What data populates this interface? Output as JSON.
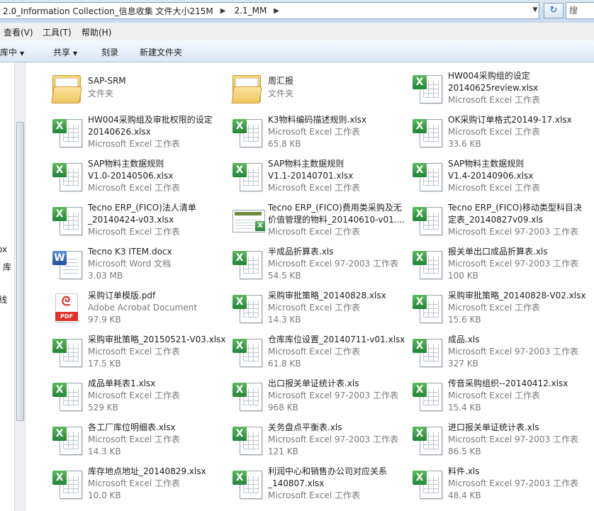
{
  "address": {
    "path": [
      "2.0_Information Collection_信息收集 文件大小215M",
      "2.1_MM"
    ],
    "search_placeholder": "搜"
  },
  "menu": [
    "查看(V)",
    "工具(T)",
    "帮助(H)"
  ],
  "toolbar": {
    "library": "到库中",
    "share": "共享",
    "burn": "刻录",
    "new_folder": "新建文件夹"
  },
  "nav": [
    "ox",
    "库",
    "线"
  ],
  "files": [
    {
      "name": "SAP-SRM",
      "line2": "",
      "type": "文件夹",
      "size": "",
      "icon": "folder"
    },
    {
      "name": "周汇报",
      "line2": "",
      "type": "文件夹",
      "size": "",
      "icon": "folder"
    },
    {
      "name": "HW004采购组的设定",
      "line2": "20140625review.xlsx",
      "type": "Microsoft Excel 工作表",
      "size": "",
      "icon": "excel"
    },
    {
      "name": "HW004采购组及审批权限的设定",
      "line2": "20140626.xlsx",
      "type": "Microsoft Excel 工作表",
      "size": "",
      "icon": "excel"
    },
    {
      "name": "K3物料编码描述规则.xlsx",
      "line2": "",
      "type": "Microsoft Excel 工作表",
      "size": "65.8 KB",
      "icon": "excel"
    },
    {
      "name": "OK采购订单格式20149-17.xlsx",
      "line2": "",
      "type": "Microsoft Excel 工作表",
      "size": "33.6 KB",
      "icon": "excel"
    },
    {
      "name": "SAP物料主数据规则",
      "line2": "V1.0-20140506.xlsx",
      "type": "Microsoft Excel 工作表",
      "size": "",
      "icon": "excel"
    },
    {
      "name": "SAP物料主数据规则",
      "line2": "V1.1-20140701.xlsx",
      "type": "Microsoft Excel 工作表",
      "size": "",
      "icon": "excel"
    },
    {
      "name": "SAP物料主数据规则",
      "line2": "V1.4-20140906.xlsx",
      "type": "Microsoft Excel 工作表",
      "size": "",
      "icon": "excel"
    },
    {
      "name": "Tecno ERP_(FICO)法人清单",
      "line2": "_20140424-v03.xlsx",
      "type": "Microsoft Excel 工作表",
      "size": "",
      "icon": "excel"
    },
    {
      "name": "Tecno ERP_(FICO)费用类采购及无",
      "line2": "价值管理的物料_20140610-v01....",
      "type": "Microsoft Excel 工作表",
      "size": "",
      "icon": "image"
    },
    {
      "name": "Tecno ERP_(FICO)移动类型科目决",
      "line2": "定表_20140827v09.xls",
      "type": "Microsoft Excel 97-2003 工作表",
      "size": "",
      "icon": "excel"
    },
    {
      "name": "Tecno K3 ITEM.docx",
      "line2": "",
      "type": "Microsoft Word 文档",
      "size": "3.03 MB",
      "icon": "word"
    },
    {
      "name": "半成品折算表.xls",
      "line2": "",
      "type": "Microsoft Excel 97-2003 工作表",
      "size": "54.5 KB",
      "icon": "excel"
    },
    {
      "name": "报关单出口成品折算表.xls",
      "line2": "",
      "type": "Microsoft Excel 97-2003 工作表",
      "size": "100 KB",
      "icon": "excel"
    },
    {
      "name": "采购订单模版.pdf",
      "line2": "",
      "type": "Adobe Acrobat Document",
      "size": "97.9 KB",
      "icon": "pdf"
    },
    {
      "name": "采购审批策略_20140828.xlsx",
      "line2": "",
      "type": "Microsoft Excel 工作表",
      "size": "14.3 KB",
      "icon": "excel"
    },
    {
      "name": "采购审批策略_20140828-V02.xlsx",
      "line2": "",
      "type": "Microsoft Excel 工作表",
      "size": "15.6 KB",
      "icon": "excel"
    },
    {
      "name": "采购审批策略_20150521-V03.xlsx",
      "line2": "",
      "type": "Microsoft Excel 工作表",
      "size": "17.5 KB",
      "icon": "excel"
    },
    {
      "name": "仓库库位设置_20140711-v01.xlsx",
      "line2": "",
      "type": "Microsoft Excel 工作表",
      "size": "61.8 KB",
      "icon": "excel"
    },
    {
      "name": "成品.xls",
      "line2": "",
      "type": "Microsoft Excel 97-2003 工作表",
      "size": "327 KB",
      "icon": "excel"
    },
    {
      "name": "成品单耗表1.xlsx",
      "line2": "",
      "type": "Microsoft Excel 工作表",
      "size": "529 KB",
      "icon": "excel"
    },
    {
      "name": "出口报关单证统计表.xls",
      "line2": "",
      "type": "Microsoft Excel 97-2003 工作表",
      "size": "968 KB",
      "icon": "excel"
    },
    {
      "name": "传音采购组织--20140412.xlsx",
      "line2": "",
      "type": "Microsoft Excel 工作表",
      "size": "15.4 KB",
      "icon": "excel"
    },
    {
      "name": "各工厂库位明细表.xlsx",
      "line2": "",
      "type": "Microsoft Excel 工作表",
      "size": "14.3 KB",
      "icon": "excel"
    },
    {
      "name": "关务盘点平衡表.xls",
      "line2": "",
      "type": "Microsoft Excel 97-2003 工作表",
      "size": "121 KB",
      "icon": "excel"
    },
    {
      "name": "进口报关单证统计表.xls",
      "line2": "",
      "type": "Microsoft Excel 97-2003 工作表",
      "size": "86.5 KB",
      "icon": "excel"
    },
    {
      "name": "库存地点地址_20140829.xlsx",
      "line2": "",
      "type": "Microsoft Excel 工作表",
      "size": "10.0 KB",
      "icon": "excel"
    },
    {
      "name": "利润中心和销售办公司对应关系",
      "line2": "_140807.xlsx",
      "type": "Microsoft Excel 工作表",
      "size": "",
      "icon": "excel"
    },
    {
      "name": "料件.xls",
      "line2": "",
      "type": "Microsoft Excel 97-2003 工作表",
      "size": "48.4 KB",
      "icon": "excel"
    }
  ]
}
